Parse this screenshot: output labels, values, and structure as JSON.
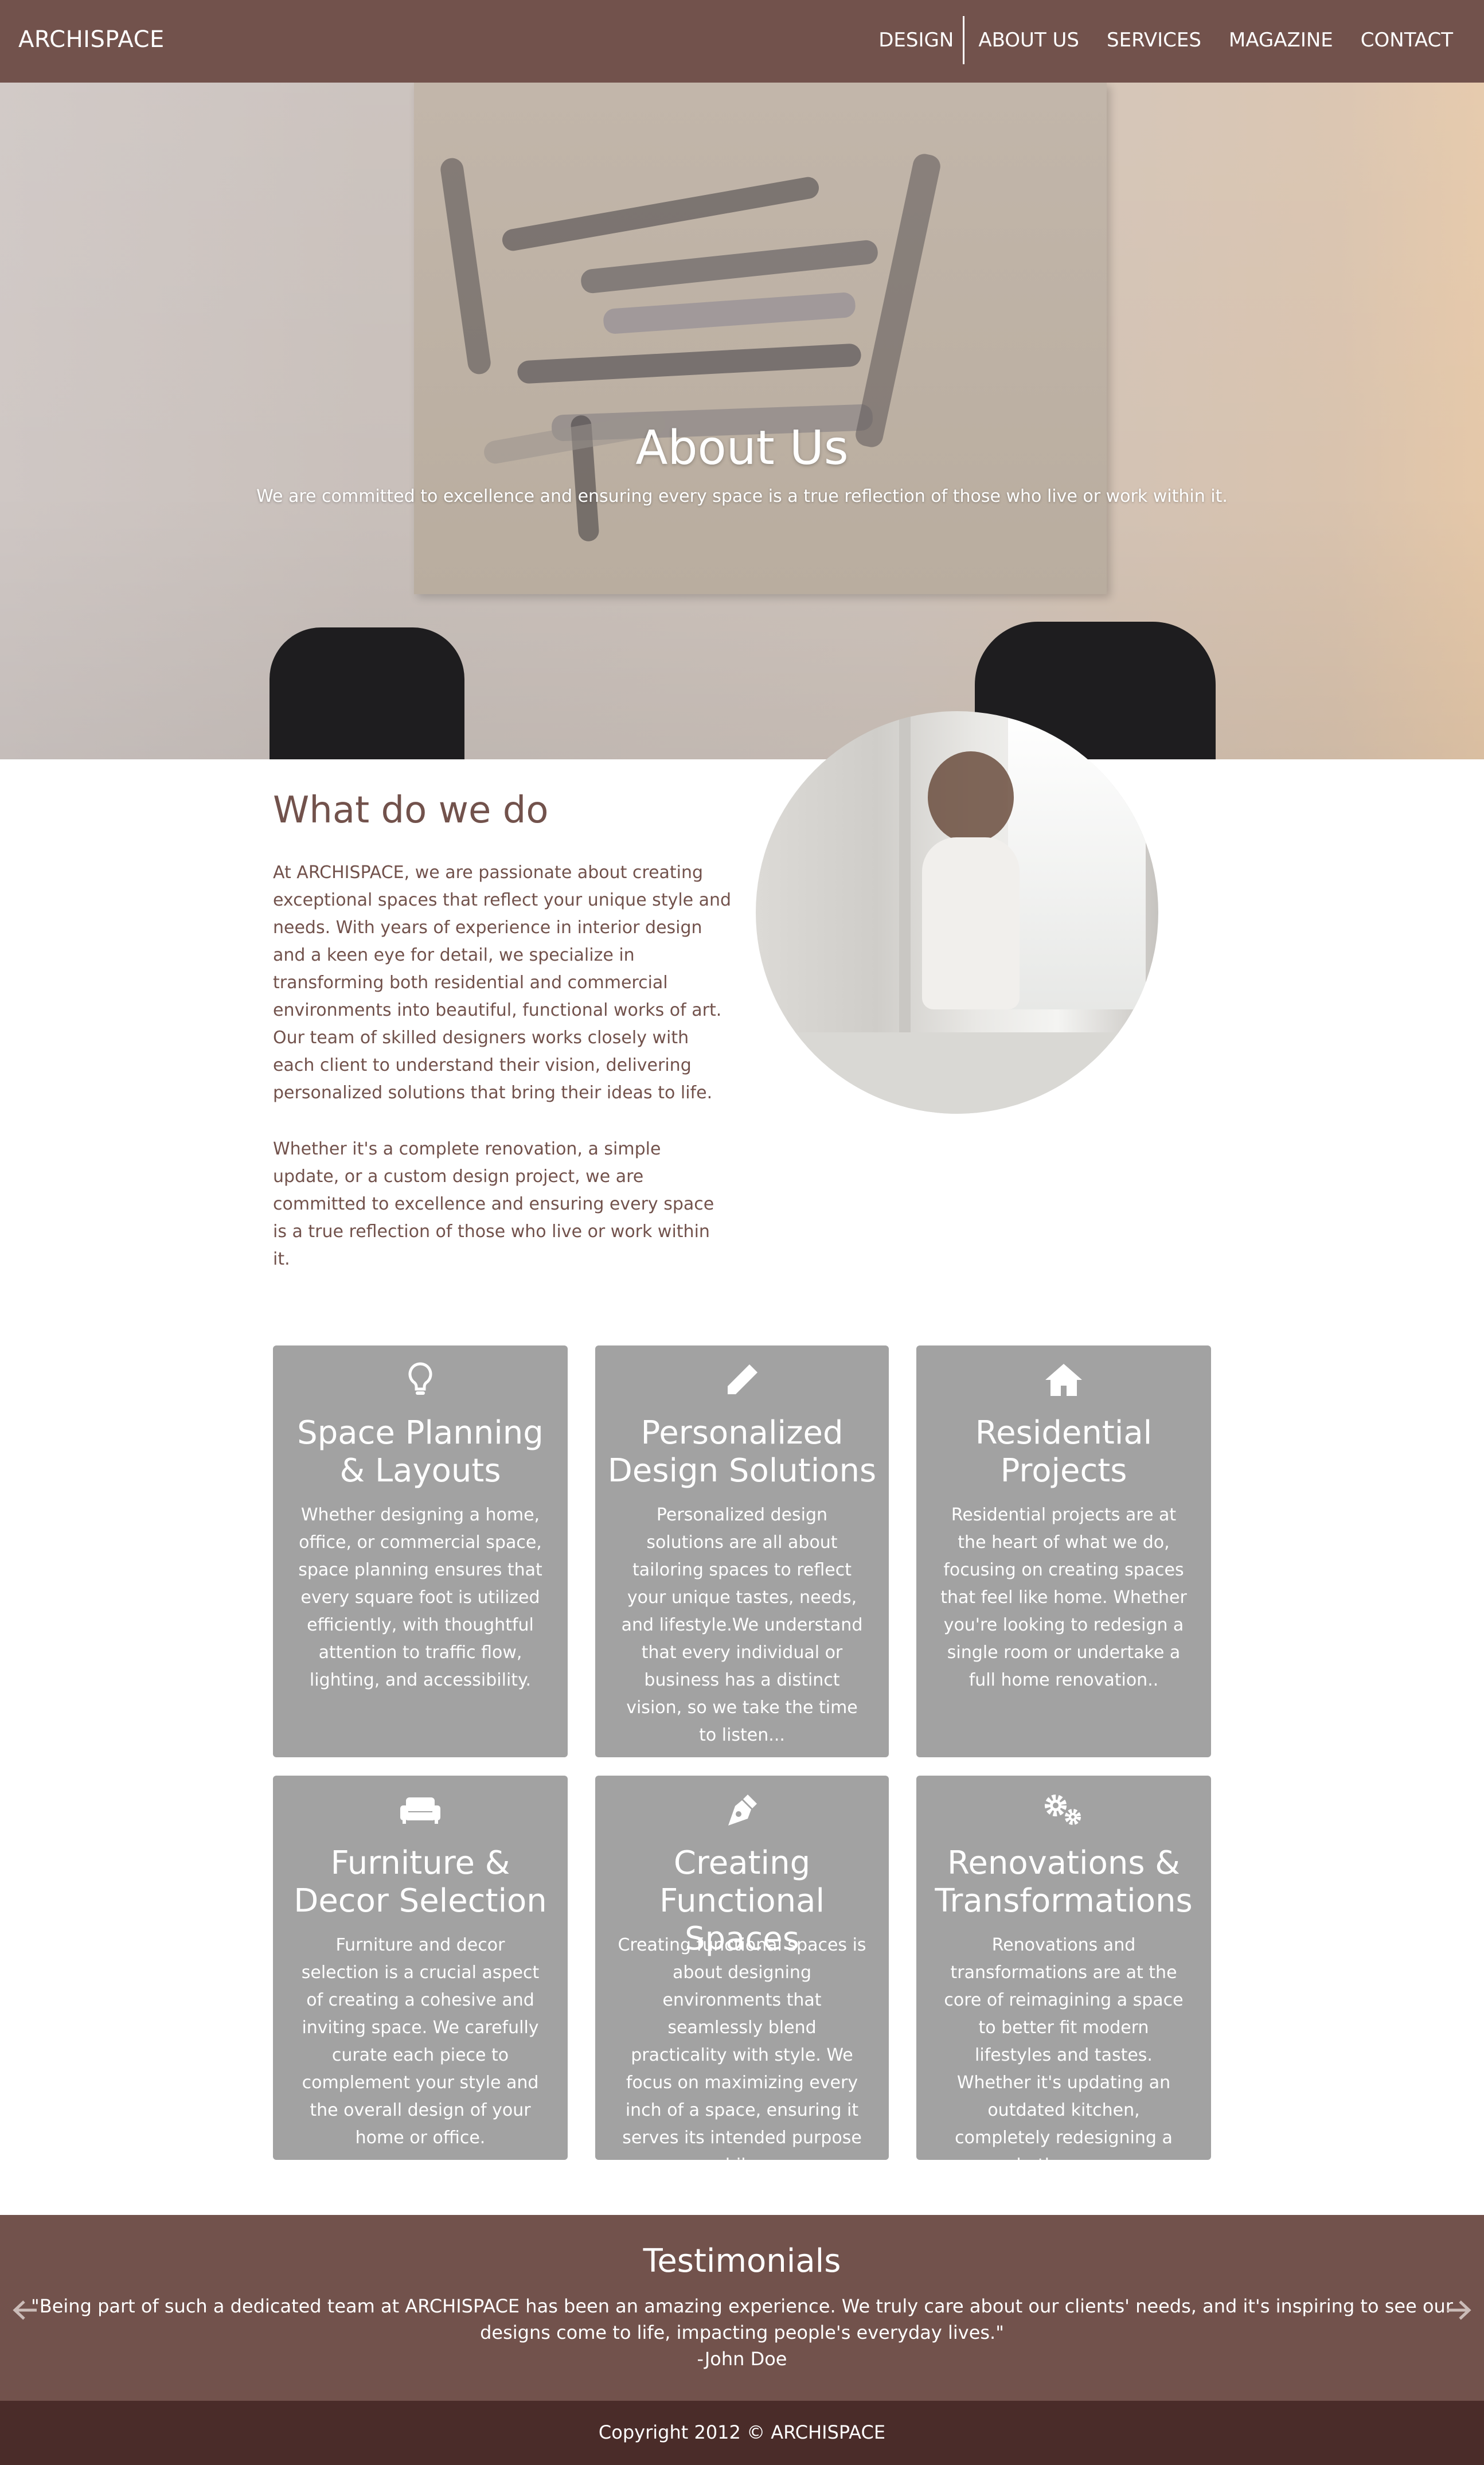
{
  "header": {
    "logo": "ARCHISPACE",
    "nav": [
      "DESIGN",
      "ABOUT US",
      "SERVICES",
      "MAGAZINE",
      "CONTACT"
    ]
  },
  "hero": {
    "title": "About Us",
    "subtitle": "We are committed to excellence and ensuring every space is a true reflection of those who live or work within it."
  },
  "about": {
    "heading": "What do we do",
    "p1": "At ARCHISPACE, we are passionate about creating exceptional spaces that reflect your unique style and needs. With years of experience in interior design and a keen eye for detail, we specialize in transforming both residential and commercial environments into beautiful, functional works of art. Our team of skilled designers works closely with each client to understand their vision, delivering personalized solutions that bring their ideas to life.",
    "p2": "Whether it's a complete renovation, a simple update, or a custom design project, we are committed to excellence and ensuring every space is a true reflection of those who live or work within it."
  },
  "services": [
    {
      "icon": "lightbulb-icon",
      "title": "Space Planning & Layouts",
      "text": "Whether designing a home, office, or commercial space, space planning ensures that every square foot is utilized efficiently, with thoughtful attention to traffic flow, lighting, and accessibility."
    },
    {
      "icon": "pencil-icon",
      "title": "Personalized Design Solutions",
      "text": "Personalized design solutions are all about tailoring spaces to reflect your unique tastes, needs, and lifestyle.We understand that every individual or business has a distinct vision, so we take the time to listen..."
    },
    {
      "icon": "home-icon",
      "title": "Residential Projects",
      "text": "Residential projects are at the heart of what we do, focusing on creating spaces that feel like home. Whether you're looking to redesign a single room or undertake a full home renovation.."
    },
    {
      "icon": "sofa-icon",
      "title": "Furniture & Decor Selection",
      "text": "Furniture and decor selection is a crucial aspect of creating a cohesive and inviting space. We carefully curate each piece to complement your style and the overall design of your home or office."
    },
    {
      "icon": "pen-nib-icon",
      "title": "Creating Functional Spaces",
      "text": "Creating functional spaces is about designing environments that seamlessly blend practicality with style. We focus on maximizing every inch of a space, ensuring it serves its intended purpose while..."
    },
    {
      "icon": "gears-icon",
      "title": "Renovations & Transformations",
      "text": "Renovations and transformations are at the core of reimagining a space to better fit modern lifestyles and tastes. Whether it's updating an outdated kitchen, completely redesigning a bathroom.."
    }
  ],
  "testimonials": {
    "title": "Testimonials",
    "quote": "\"Being part of such a dedicated team at ARCHISPACE has been an amazing experience. We truly care about our clients' needs, and it's inspiring to see our designs come to life, impacting people's everyday lives.\"",
    "author": "-John Doe"
  },
  "footer": {
    "copyright": "Copyright 2012 © ARCHISPACE"
  },
  "colors": {
    "brand": "#72524c",
    "footer": "#4a2c29",
    "card": "#a2a2a2"
  }
}
